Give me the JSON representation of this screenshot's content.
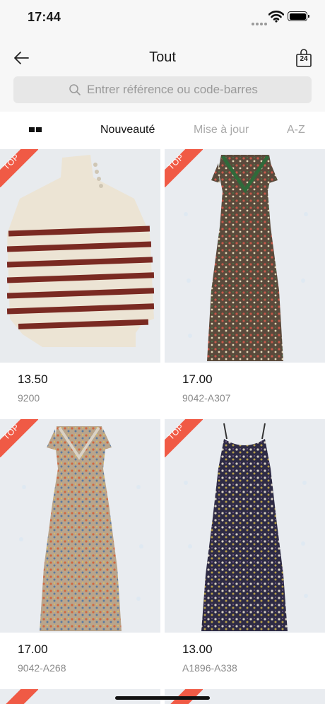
{
  "status_bar": {
    "time": "17:44"
  },
  "header": {
    "title": "Tout",
    "cart_count": "24"
  },
  "search": {
    "placeholder": "Entrer référence ou code-barres"
  },
  "sort_tabs": [
    {
      "label": "Nouveauté",
      "active": true
    },
    {
      "label": "Mise à jour",
      "active": false
    },
    {
      "label": "A-Z",
      "active": false
    }
  ],
  "products": [
    {
      "badge": "TOP",
      "price": "13.50",
      "ref": "9200",
      "image": "striped-sweater"
    },
    {
      "badge": "TOP",
      "price": "17.00",
      "ref": "9042-A307",
      "image": "floral-dress-green-collar"
    },
    {
      "badge": "TOP",
      "price": "17.00",
      "ref": "9042-A268",
      "image": "floral-dress-light"
    },
    {
      "badge": "TOP",
      "price": "13.00",
      "ref": "A1896-A338",
      "image": "floral-slip-dress-navy"
    }
  ],
  "colors": {
    "badge": "#f05a45",
    "sweater_stripe": "#7a2a22",
    "sweater_base": "#ece4d4"
  }
}
